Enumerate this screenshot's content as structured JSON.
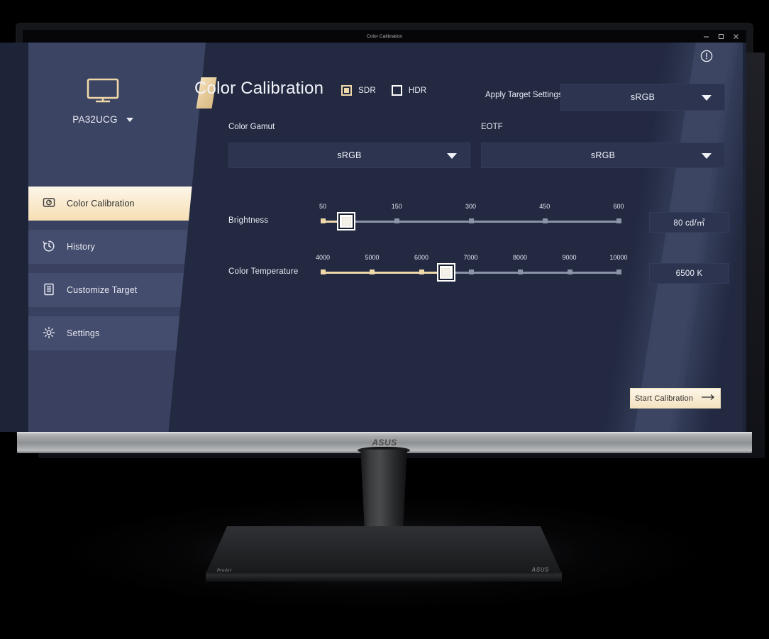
{
  "window": {
    "title": "Color Calibration",
    "minimize_icon": "minimize-icon",
    "maximize_icon": "maximize-icon",
    "close_icon": "close-icon"
  },
  "sidebar": {
    "device_icon": "monitor-icon",
    "device_name": "PA32UCG",
    "device_caret": "chevron-down-icon",
    "items": [
      {
        "label": "Color Calibration",
        "icon": "color-calibration-icon",
        "active": true
      },
      {
        "label": "History",
        "icon": "history-clock-icon",
        "active": false
      },
      {
        "label": "Customize Target",
        "icon": "customize-target-icon",
        "active": false
      },
      {
        "label": "Settings",
        "icon": "gear-icon",
        "active": false
      }
    ]
  },
  "header": {
    "title": "Color Calibration",
    "info_icon": "exclamation-circle-icon",
    "modes": [
      {
        "label": "SDR",
        "checked": true
      },
      {
        "label": "HDR",
        "checked": false
      }
    ],
    "apply_target_label": "Apply Target Settings",
    "apply_target_value": "sRGB"
  },
  "fields": {
    "color_gamut_label": "Color Gamut",
    "color_gamut_value": "sRGB",
    "eotf_label": "EOTF",
    "eotf_value": "sRGB"
  },
  "sliders": {
    "brightness": {
      "name": "Brightness",
      "ticks": [
        "50",
        "150",
        "300",
        "450",
        "600"
      ],
      "value": "80 cd/㎡",
      "thumb_percent": 8,
      "filled_ticks": 1
    },
    "color_temperature": {
      "name": "Color Temperature",
      "ticks": [
        "4000",
        "5000",
        "6000",
        "7000",
        "8000",
        "9000",
        "10000"
      ],
      "value": "6500 K",
      "thumb_percent": 41.7,
      "filled_ticks": 3
    }
  },
  "actions": {
    "start_calibration": "Start Calibration",
    "start_calibration_icon": "arrow-right-icon"
  },
  "hardware": {
    "bezel_brand": "ASUS",
    "base_brand": "ASUS",
    "base_series": "ProArt"
  },
  "colors": {
    "accent": "#f0d9a9",
    "sidebar": "#3a4160",
    "panel": "#222941",
    "text": "#f0f2f7"
  }
}
